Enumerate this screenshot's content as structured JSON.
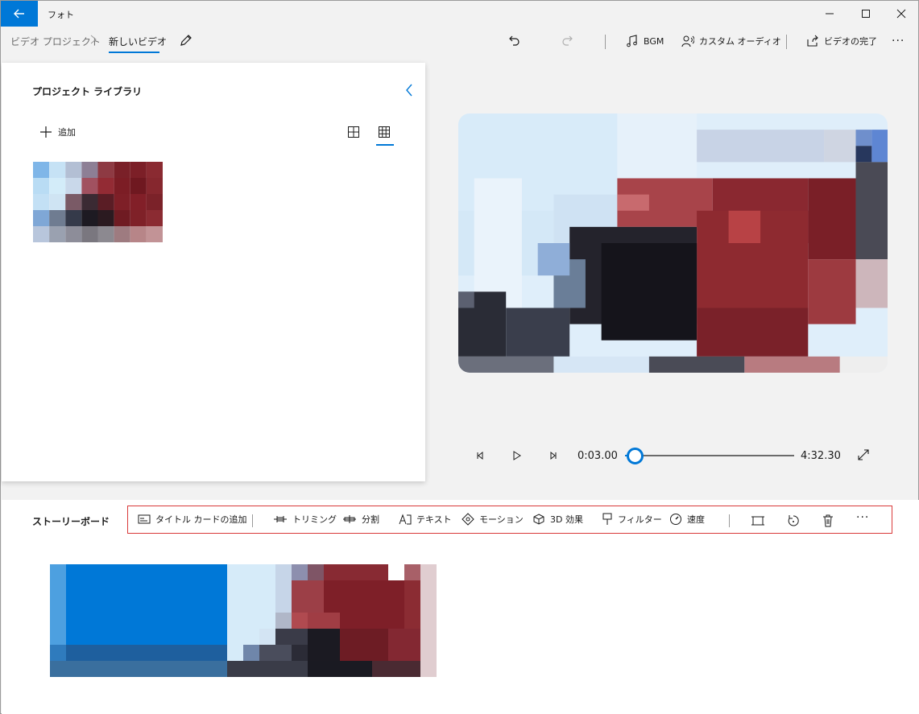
{
  "app": {
    "title": "フォト"
  },
  "breadcrumb": {
    "parent": "ビデオ プロジェクト",
    "separator": ">",
    "current": "新しいビデオ"
  },
  "header": {
    "bgm_label": "BGM",
    "custom_audio_label": "カスタム オーディオ",
    "finish_video_label": "ビデオの完了",
    "more_label": "···"
  },
  "library": {
    "title": "プロジェクト ライブラリ",
    "add_label": "追加",
    "collapse_label": "<"
  },
  "playback": {
    "current_time": "0:03.00",
    "total_time": "4:32.30",
    "progress_fraction": 0.011
  },
  "storyboard": {
    "title": "ストーリーボード",
    "toolbar": {
      "add_title_card": "タイトル カードの追加",
      "trim": "トリミング",
      "split": "分割",
      "text": "テキスト",
      "motion": "モーション",
      "effects_3d": "3D 効果",
      "filter": "フィルター",
      "speed": "速度",
      "more": "···"
    }
  },
  "colors": {
    "accent": "#0078d7",
    "highlight_border": "#d93a3a"
  }
}
